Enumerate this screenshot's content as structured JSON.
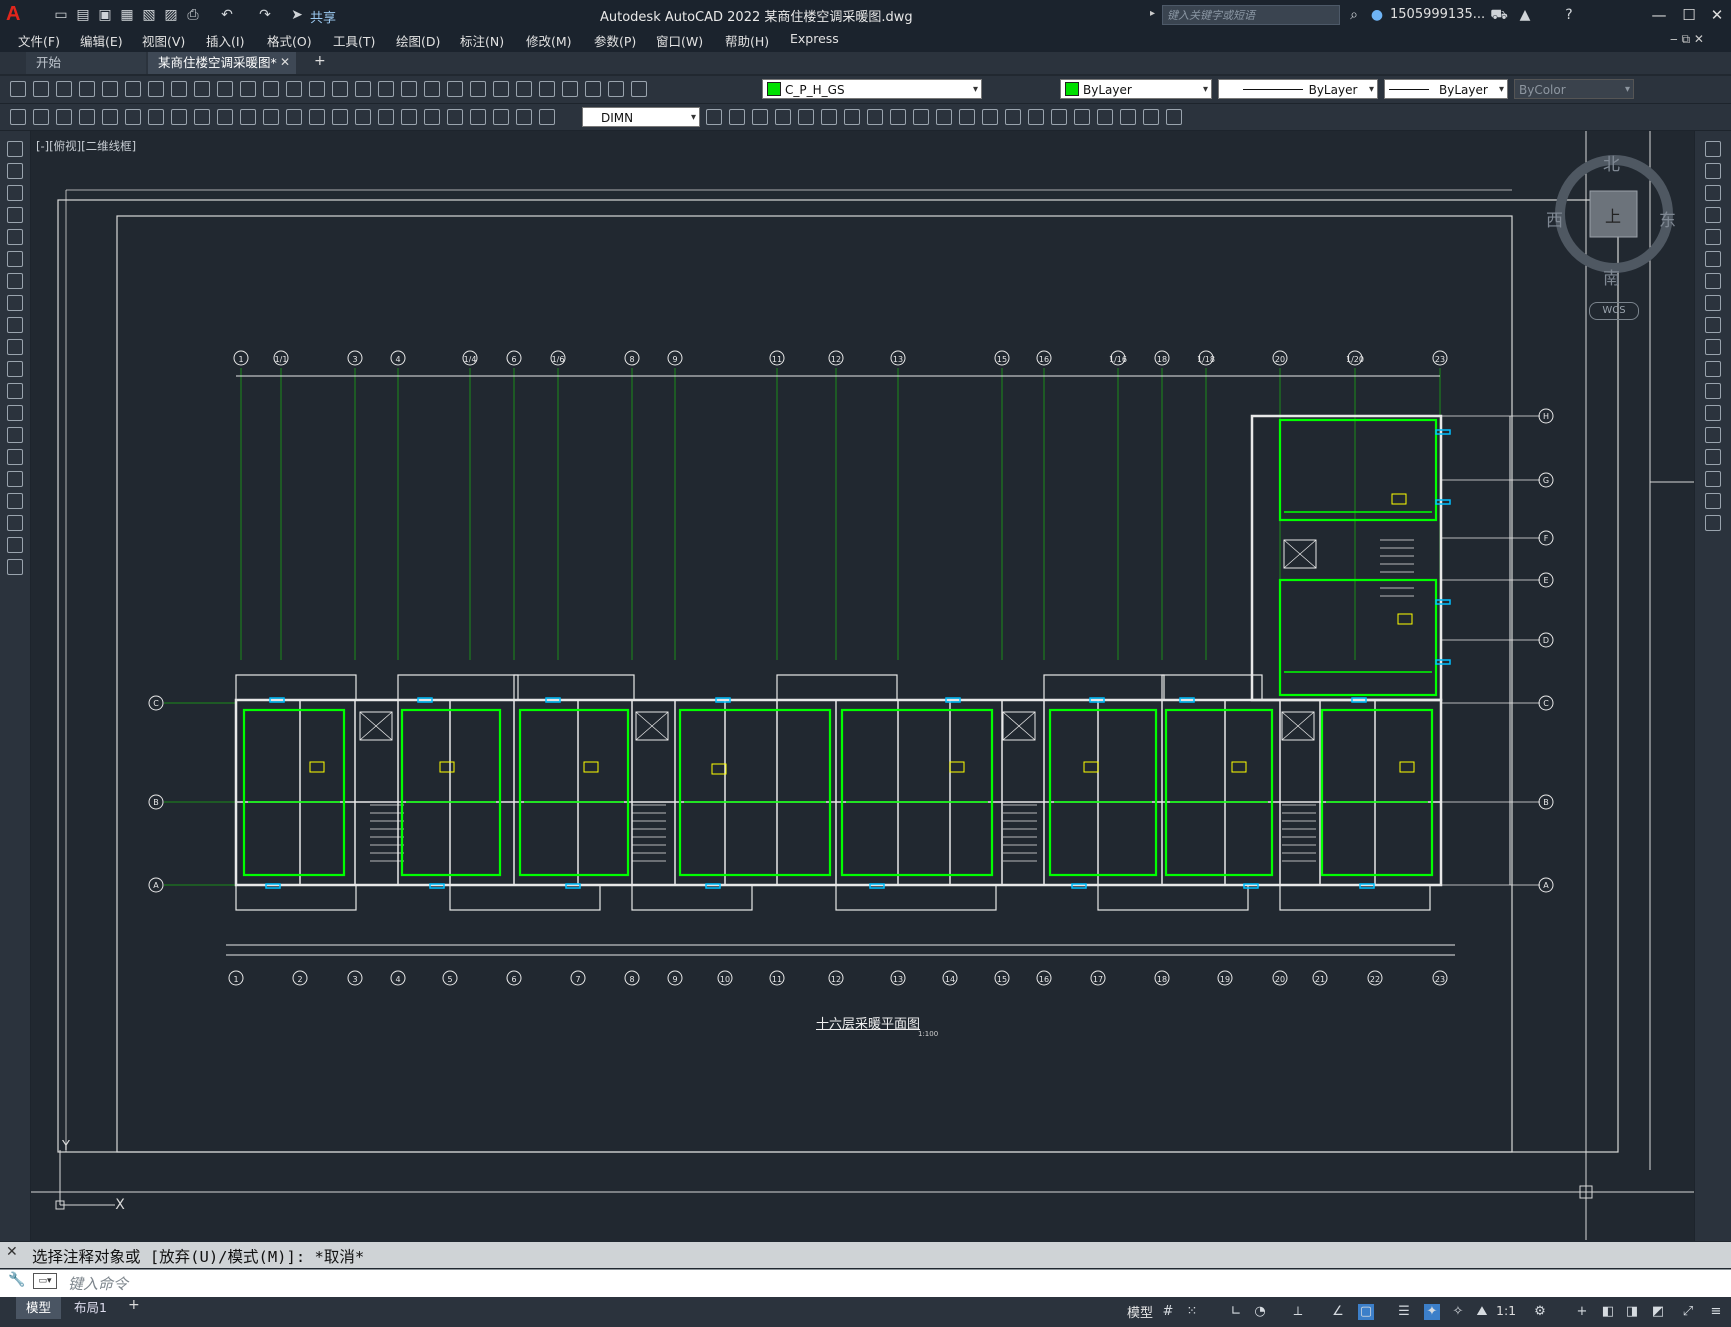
{
  "app": {
    "logo": "A",
    "window_title": "Autodesk AutoCAD 2022    某商住楼空调采暖图.dwg",
    "share_label": "共享",
    "search_placeholder": "键入关键字或短语",
    "user_name": "1505999135...",
    "window_controls": [
      "—",
      "☐",
      "✕"
    ]
  },
  "menu": {
    "items": [
      "文件(F)",
      "编辑(E)",
      "视图(V)",
      "插入(I)",
      "格式(O)",
      "工具(T)",
      "绘图(D)",
      "标注(N)",
      "修改(M)",
      "参数(P)",
      "窗口(W)",
      "帮助(H)",
      "Express"
    ]
  },
  "tabs": {
    "start": "开始",
    "document": "某商住楼空调采暖图*",
    "close": "✕",
    "add": "+"
  },
  "toolbar": {
    "layer_name": "C_P_H_GS",
    "color": "ByLayer",
    "linetype": "ByLayer",
    "lineweight": "ByLayer",
    "plotstyle": "ByColor",
    "dimstyle": "DIMN",
    "layer_color_hex": "#00e000"
  },
  "viewport": {
    "label": "[-][俯视][二维线框]",
    "compass": {
      "north": "北",
      "south": "南",
      "east": "东",
      "west": "西",
      "center": "上"
    },
    "wcs": "WCS"
  },
  "drawing": {
    "title": "十六层采暖平面图",
    "scale_note": "1:100",
    "top_axes": [
      "1",
      "1/1",
      "3",
      "4",
      "1/4",
      "6",
      "1/6",
      "8",
      "9",
      "11",
      "12",
      "13",
      "15",
      "16",
      "1/16",
      "18",
      "1/18",
      "20",
      "1/20",
      "23"
    ],
    "bottom_axes": [
      "1",
      "2",
      "3",
      "4",
      "5",
      "6",
      "7",
      "8",
      "9",
      "10",
      "11",
      "12",
      "13",
      "14",
      "15",
      "16",
      "17",
      "18",
      "19",
      "20",
      "21",
      "22",
      "23"
    ],
    "right_axes": [
      "H",
      "G",
      "F",
      "E",
      "D",
      "C",
      "B",
      "A"
    ],
    "left_axes": [
      "C",
      "B",
      "A"
    ],
    "colors": {
      "wall": "#e8e8e8",
      "pipe": "#00ff00",
      "grid": "#1a8c1a",
      "frame": "#d8d8d8",
      "fixture": "#00bfff",
      "label": "#ffff00"
    }
  },
  "command": {
    "history": "选择注释对象或 [放弃(U)/模式(M)]: *取消*",
    "placeholder": "键入命令"
  },
  "status": {
    "layout_tabs": [
      "模型",
      "布局1"
    ],
    "add": "+",
    "model_label": "模型",
    "scale": "1:1"
  }
}
